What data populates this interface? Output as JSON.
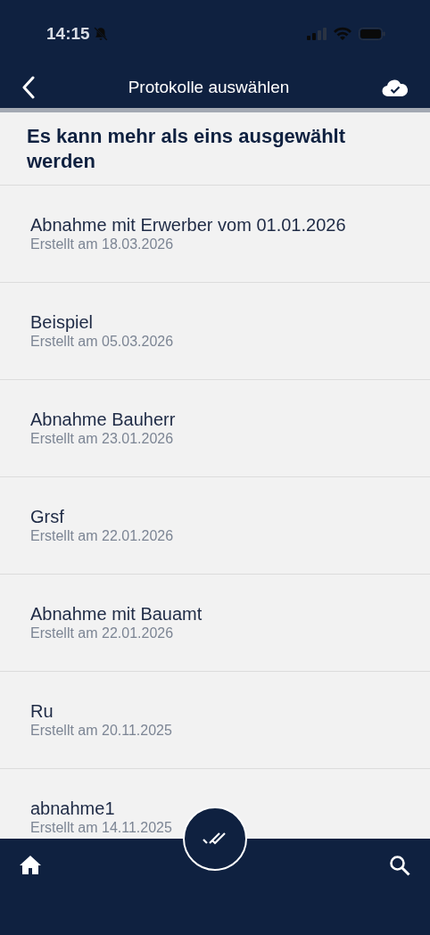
{
  "status_bar": {
    "time": "14:15",
    "muted": true
  },
  "nav_bar": {
    "title": "Protokolle auswählen"
  },
  "header": {
    "text": "Es kann mehr als eins ausgewählt werden"
  },
  "protocols": [
    {
      "title": "Abnahme mit Erwerber vom 01.01.2026",
      "subtitle": "Erstellt am 18.03.2026"
    },
    {
      "title": "Beispiel",
      "subtitle": "Erstellt am 05.03.2026"
    },
    {
      "title": "Abnahme Bauherr",
      "subtitle": "Erstellt am 23.01.2026"
    },
    {
      "title": "Grsf",
      "subtitle": "Erstellt am 22.01.2026"
    },
    {
      "title": "Abnahme mit Bauamt",
      "subtitle": "Erstellt am 22.01.2026"
    },
    {
      "title": "Ru",
      "subtitle": "Erstellt am 20.11.2025"
    },
    {
      "title": "abnahme1",
      "subtitle": "Erstellt am 14.11.2025"
    }
  ]
}
